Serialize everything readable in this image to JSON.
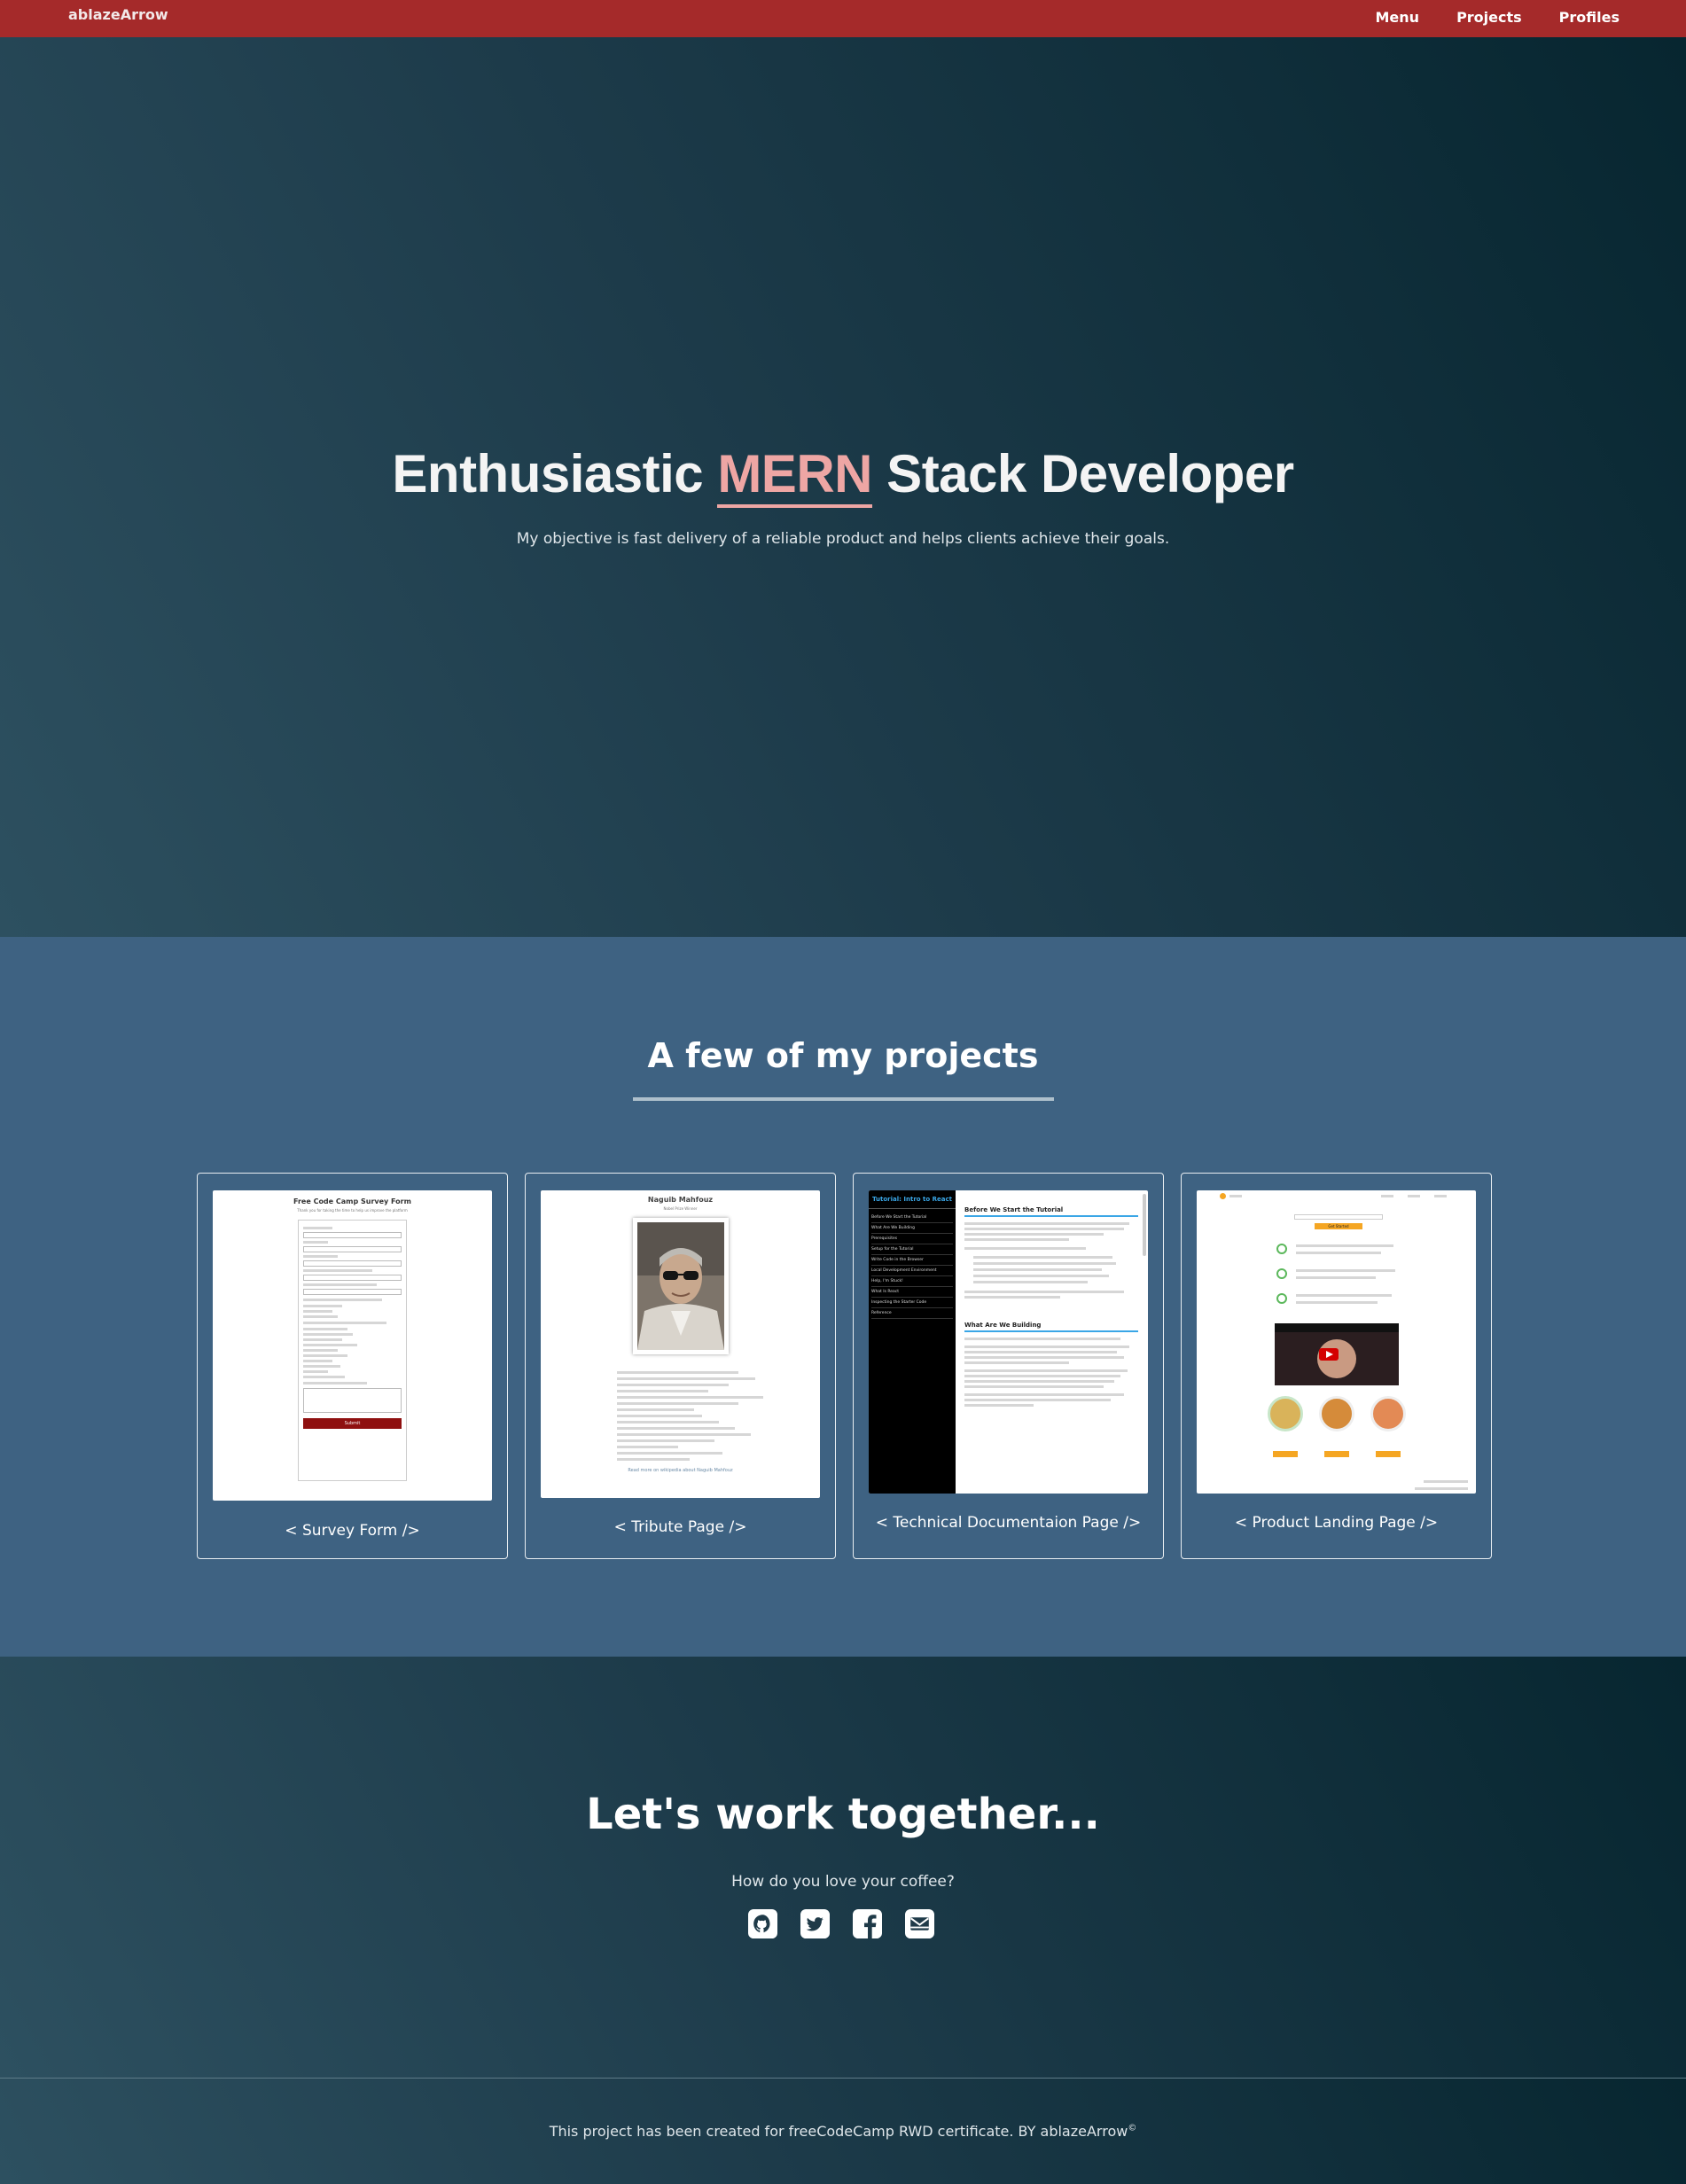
{
  "nav": {
    "brand": "ablazeArrow",
    "links": [
      "Menu",
      "Projects",
      "Profiles"
    ]
  },
  "hero": {
    "title_before": "Enthusiastic",
    "title_accent": "MERN",
    "title_after": "Stack Developer",
    "subtitle": "My objective is fast delivery of a reliable product and helps clients achieve their goals."
  },
  "projects": {
    "heading": "A few of my projects",
    "cards": [
      {
        "label": "< Survey Form />",
        "thumb_title": "Free Code Camp Survey Form",
        "thumb_subtitle": "Thank you for taking the time to help us improve the platform",
        "thumb_button": "Submit"
      },
      {
        "label": "< Tribute Page />",
        "thumb_title": "Naguib Mahfouz",
        "thumb_subtitle": "Nobel Prize Winner",
        "thumb_link": "Read more on wikipedia about Naguib Mahfouz"
      },
      {
        "label": "< Technical Documentaion Page />",
        "thumb_nav_title": "Tutorial: Intro to React",
        "thumb_nav_items": [
          "Before We Start the Tutorial",
          "What Are We Building",
          "Prerequisites",
          "Setup for the Tutorial",
          "Write Code in the Browser",
          "Local Development Environment",
          "Help, I'm Stuck!",
          "What Is React",
          "Inspecting the Starter Code",
          "Reference"
        ],
        "thumb_heading_1": "Before We Start the Tutorial",
        "thumb_heading_2": "What Are We Building"
      },
      {
        "label": "< Product Landing Page />",
        "thumb_button": "Get Started"
      }
    ]
  },
  "contact": {
    "heading": "Let's work together...",
    "subtitle": "How do you love your coffee?",
    "icons": [
      "github-icon",
      "twitter-icon",
      "facebook-icon",
      "email-icon"
    ]
  },
  "footer": {
    "text": "This project has been created for freeCodeCamp RWD certificate. BY ablazeArrow",
    "symbol": "©"
  },
  "colors": {
    "nav": "#a52a2a",
    "accent": "#eea6a4",
    "projects_bg": "#3e6282"
  }
}
